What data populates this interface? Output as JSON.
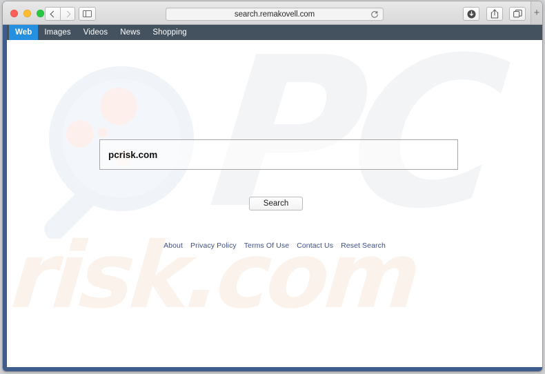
{
  "browser": {
    "traffic_lights": {
      "close_color": "#ff5f57",
      "minimize_color": "#ffbd2e",
      "maximize_color": "#28c840"
    },
    "address_bar": {
      "url": "search.remakovell.com",
      "reload_icon": "reload-icon"
    },
    "buttons": {
      "back": "back-icon",
      "forward": "forward-icon",
      "sidebar": "sidebar-icon",
      "download": "download-icon",
      "share": "share-icon",
      "tabs": "tabs-icon",
      "new_tab": "+"
    }
  },
  "site": {
    "nav": {
      "items": [
        {
          "label": "Web",
          "active": true
        },
        {
          "label": "Images",
          "active": false
        },
        {
          "label": "Videos",
          "active": false
        },
        {
          "label": "News",
          "active": false
        },
        {
          "label": "Shopping",
          "active": false
        }
      ],
      "background_color": "#44525f",
      "active_color": "#2590e0"
    },
    "search": {
      "query": "pcrisk.com",
      "placeholder": "",
      "button_label": "Search"
    },
    "footer": {
      "links": [
        "About",
        "Privacy Policy",
        "Terms Of Use",
        "Contact Us",
        "Reset Search"
      ],
      "link_color": "#3d4f8c"
    },
    "watermarks": {
      "logo_text": "PC",
      "domain_text": "risk.com",
      "logo_color": "#f3f4f6",
      "domain_color": "#fcf2ec",
      "magnifier_color": "#f0f3f7",
      "magnifier_accent_color": "#fdf0ec"
    }
  }
}
